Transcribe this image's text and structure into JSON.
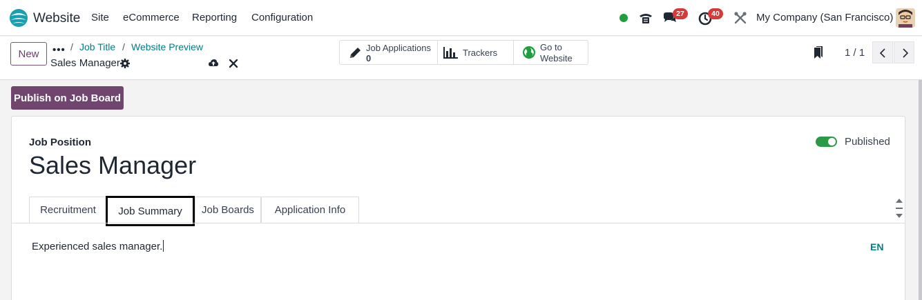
{
  "nav": {
    "app_name": "Website",
    "menu": [
      "Site",
      "eCommerce",
      "Reporting",
      "Configuration"
    ],
    "messages_count": "27",
    "activities_count": "40",
    "company": "My Company (San Francisco)"
  },
  "control": {
    "new_label": "New",
    "breadcrumb_dots": "•••",
    "breadcrumbs": [
      "Job Title",
      "Website Preview"
    ],
    "record_name": "Sales Manager",
    "smart_buttons": {
      "job_applications": {
        "label": "Job Applications",
        "count": "0"
      },
      "trackers": {
        "label": "Trackers"
      },
      "go_to_website": {
        "line1": "Go to",
        "line2": "Website"
      }
    },
    "pager": "1 / 1"
  },
  "actions": {
    "publish_label": "Publish on Job Board"
  },
  "form": {
    "job_position_label": "Job Position",
    "job_title": "Sales Manager",
    "published_label": "Published",
    "published": true,
    "tabs": [
      "Recruitment",
      "Job Summary",
      "Job Boards",
      "Application Info"
    ],
    "active_tab": "Job Summary",
    "summary_text": "Experienced sales manager.",
    "language": "EN"
  },
  "colors": {
    "brand": "#71466e",
    "link": "#017e84",
    "toggle_on": "#2b9a47",
    "badge": "#d43a3a",
    "status_online": "#1e9e3c"
  },
  "icons": [
    "app-logo-icon",
    "phone-icon",
    "chat-icon",
    "clock-icon",
    "tools-icon",
    "gear-icon",
    "cloud-upload-icon",
    "close-icon",
    "pencil-icon",
    "bar-chart-icon",
    "globe-icon",
    "bookmark-icon",
    "chevron-left-icon",
    "chevron-right-icon"
  ]
}
